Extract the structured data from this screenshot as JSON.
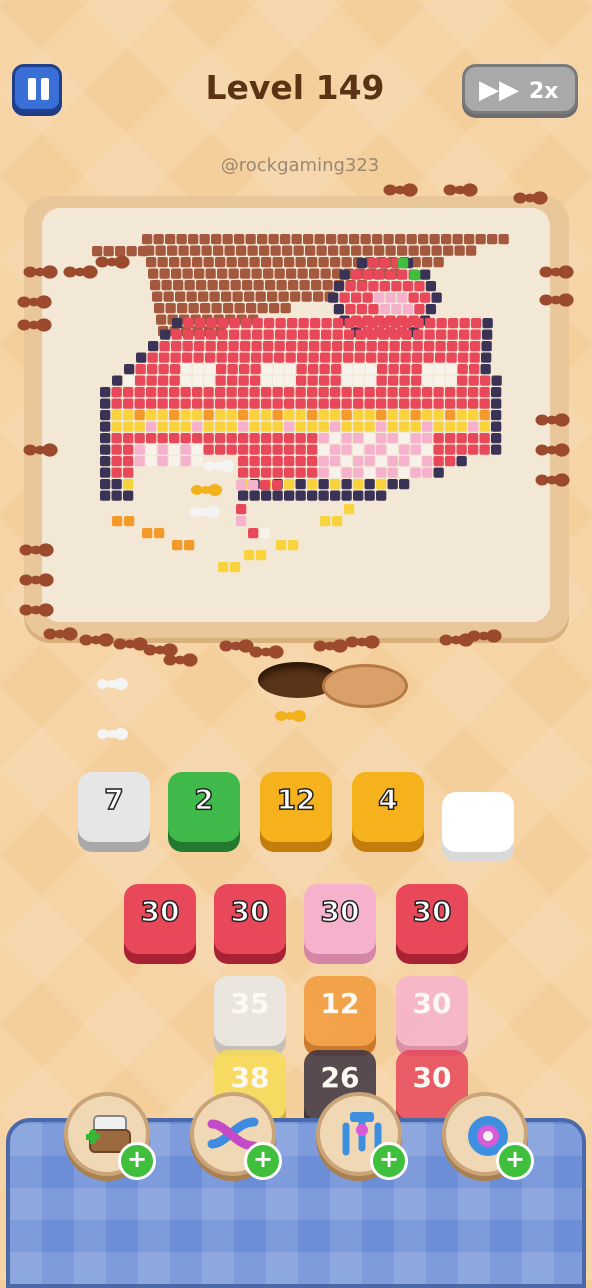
{
  "hud": {
    "level_title": "Level 149",
    "speed_label": "2x",
    "watermark": "@rockgaming323"
  },
  "slots": [
    {
      "value": "7",
      "color": "#e6e6e6",
      "shade": "#a9a9a9"
    },
    {
      "value": "2",
      "color": "#3fb94a",
      "shade": "#237a2e"
    },
    {
      "value": "12",
      "color": "#f5b21c",
      "shade": "#c27d0c"
    },
    {
      "value": "4",
      "color": "#f5b21c",
      "shade": "#c27d0c"
    },
    {
      "value": "",
      "color": "#ffffff",
      "shade": "#d9d9d9"
    }
  ],
  "queue": {
    "row1": [
      {
        "value": "30",
        "color": "#e9485a",
        "shade": "#a82233"
      },
      {
        "value": "30",
        "color": "#e9485a",
        "shade": "#a82233"
      },
      {
        "value": "30",
        "color": "#f6b2cc",
        "shade": "#d386a6"
      },
      {
        "value": "30",
        "color": "#e9485a",
        "shade": "#a82233"
      }
    ],
    "row2": [
      {
        "value": "35",
        "color": "#e8e8e8",
        "shade": "#bdbdbd"
      },
      {
        "value": "12",
        "color": "#f29a3a",
        "shade": "#c46b16"
      },
      {
        "value": "30",
        "color": "#f6b2cc",
        "shade": "#d386a6"
      }
    ],
    "row3": [
      {
        "value": "38",
        "color": "#f8dc57",
        "shade": "#cfa91f"
      },
      {
        "value": "26",
        "color": "#3d3442",
        "shade": "#221d26"
      },
      {
        "value": "30",
        "color": "#e9485a",
        "shade": "#a82233"
      }
    ]
  },
  "powerups": [
    {
      "icon": "add-slot-icon"
    },
    {
      "icon": "shuffle-icon"
    },
    {
      "icon": "magnet-claw-icon"
    },
    {
      "icon": "donut-icon"
    }
  ],
  "colors": {
    "red": "#e9485a",
    "pink": "#f6b2cc",
    "yellow": "#f8d33b",
    "orange": "#f39a2a",
    "white": "#f7f2ea",
    "navy": "#3b3355",
    "brown": "#a4583d",
    "green": "#3fbf3c"
  }
}
